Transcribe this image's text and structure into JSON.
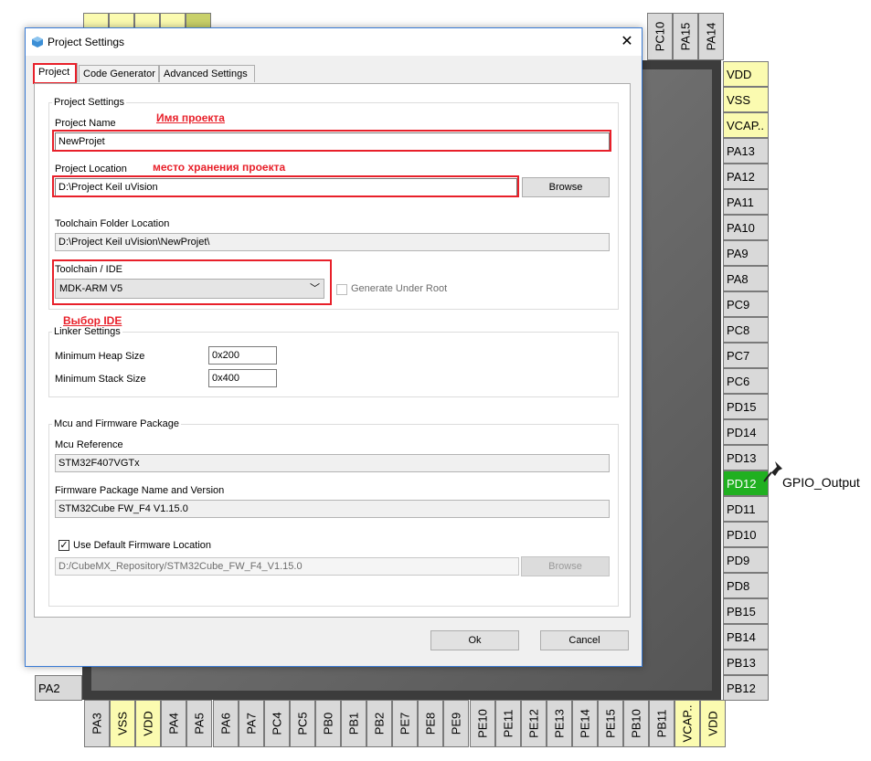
{
  "dialog": {
    "title": "Project Settings",
    "close_glyph": "✕",
    "tabs": [
      {
        "label": "Project",
        "active": true
      },
      {
        "label": "Code Generator",
        "active": false
      },
      {
        "label": "Advanced Settings",
        "active": false
      }
    ],
    "project_settings": {
      "group_title": "Project Settings",
      "project_name_label": "Project Name",
      "project_name_value": "NewProjet",
      "project_location_label": "Project Location",
      "project_location_value": "D:\\Project Keil uVision",
      "browse_label": "Browse",
      "toolchain_folder_label": "Toolchain Folder Location",
      "toolchain_folder_value": "D:\\Project Keil uVision\\NewProjet\\",
      "toolchain_ide_label": "Toolchain / IDE",
      "toolchain_ide_value": "MDK-ARM V5",
      "generate_under_root_label": "Generate Under Root"
    },
    "linker_settings": {
      "group_title": "Linker Settings",
      "min_heap_label": "Minimum Heap Size",
      "min_heap_value": "0x200",
      "min_stack_label": "Minimum Stack Size",
      "min_stack_value": "0x400"
    },
    "mcu_firmware": {
      "group_title": "Mcu and Firmware Package",
      "mcu_reference_label": "Mcu Reference",
      "mcu_reference_value": "STM32F407VGTx",
      "firmware_package_label": "Firmware Package Name and Version",
      "firmware_package_value": "STM32Cube FW_F4 V1.15.0",
      "use_default_label": "Use Default Firmware Location",
      "use_default_checked": true,
      "firmware_location_value": "D:/CubeMX_Repository/STM32Cube_FW_F4_V1.15.0",
      "browse_label": "Browse"
    },
    "ok_label": "Ok",
    "cancel_label": "Cancel"
  },
  "annotations": {
    "project_name": "Имя проекта",
    "project_location": "место хранения проекта",
    "ide_choice": "Выбор IDE",
    "color": "#e8202a"
  },
  "chip": {
    "right_pins": [
      "VDD",
      "VSS",
      "VCAP..",
      "PA13",
      "PA12",
      "PA11",
      "PA10",
      "PA9",
      "PA8",
      "PC9",
      "PC8",
      "PC7",
      "PC6",
      "PD15",
      "PD14",
      "PD13",
      "PD12",
      "PD11",
      "PD10",
      "PD9",
      "PD8",
      "PB15",
      "PB14",
      "PB13",
      "PB12"
    ],
    "top_pins": [
      "PC10",
      "PA15",
      "PA14"
    ],
    "top_left_pins": [
      "",
      "",
      "",
      "",
      ":"
    ],
    "bottom_pins": [
      "PA3",
      "VSS",
      "VDD",
      "PA4",
      "PA5",
      "PA6",
      "PA7",
      "PC4",
      "PC5",
      "PB0",
      "PB1",
      "PB2",
      "PE7",
      "PE8",
      "PE9",
      "PE10",
      "PE11",
      "PE12",
      "PE13",
      "PE14",
      "PE15",
      "PB10",
      "PB11",
      "VCAP..",
      "VDD"
    ],
    "left_pins": [
      "PA2"
    ],
    "gpio_label": "GPIO_Output",
    "active_pin": "PD12",
    "colors": {
      "power": "#fbfbb0",
      "active": "#20b020",
      "default": "#d9d9d9"
    }
  }
}
